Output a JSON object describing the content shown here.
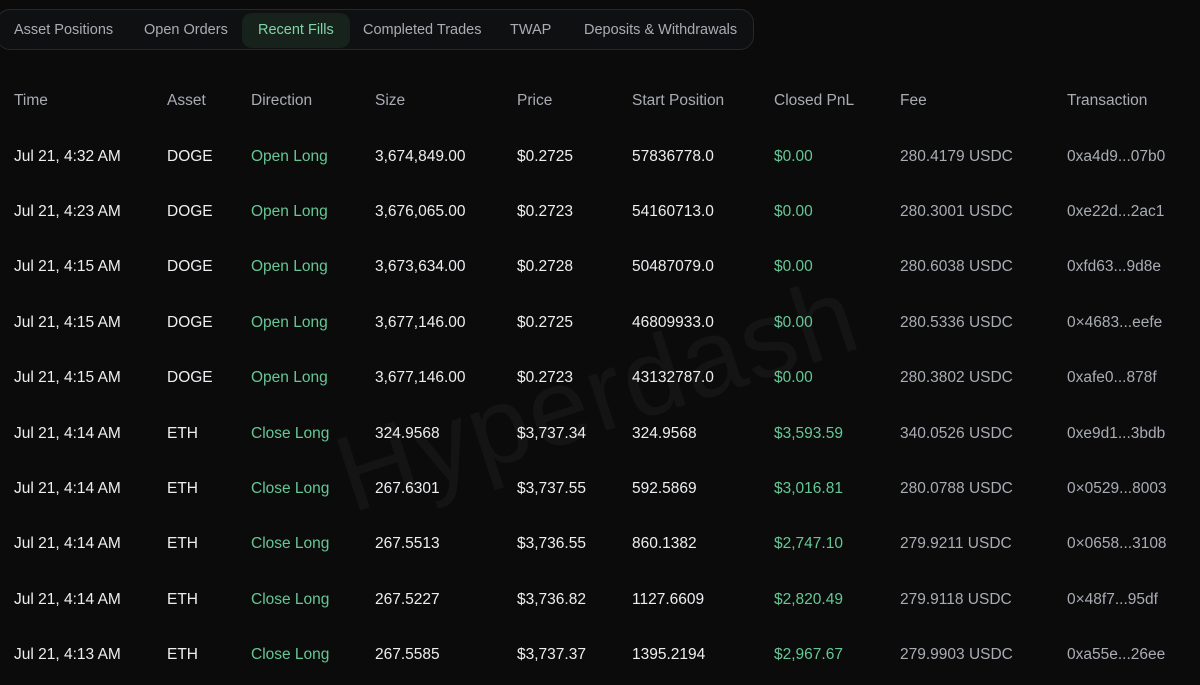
{
  "tabs": [
    {
      "label": "Asset Positions"
    },
    {
      "label": "Open Orders"
    },
    {
      "label": "Recent Fills"
    },
    {
      "label": "Completed Trades"
    },
    {
      "label": "TWAP"
    },
    {
      "label": "Deposits & Withdrawals"
    }
  ],
  "active_tab": "Recent Fills",
  "watermark": "Hyperdash",
  "columns": [
    "Time",
    "Asset",
    "Direction",
    "Size",
    "Price",
    "Start Position",
    "Closed PnL",
    "Fee",
    "Transaction"
  ],
  "rows": [
    {
      "time": "Jul 21, 4:32 AM",
      "asset": "DOGE",
      "direction": "Open Long",
      "size": "3,674,849.00",
      "price": "$0.2725",
      "start": "57836778.0",
      "pnl": "$0.00",
      "fee": "280.4179 USDC",
      "tx": "0xa4d9...07b0"
    },
    {
      "time": "Jul 21, 4:23 AM",
      "asset": "DOGE",
      "direction": "Open Long",
      "size": "3,676,065.00",
      "price": "$0.2723",
      "start": "54160713.0",
      "pnl": "$0.00",
      "fee": "280.3001 USDC",
      "tx": "0xe22d...2ac1"
    },
    {
      "time": "Jul 21, 4:15 AM",
      "asset": "DOGE",
      "direction": "Open Long",
      "size": "3,673,634.00",
      "price": "$0.2728",
      "start": "50487079.0",
      "pnl": "$0.00",
      "fee": "280.6038 USDC",
      "tx": "0xfd63...9d8e"
    },
    {
      "time": "Jul 21, 4:15 AM",
      "asset": "DOGE",
      "direction": "Open Long",
      "size": "3,677,146.00",
      "price": "$0.2725",
      "start": "46809933.0",
      "pnl": "$0.00",
      "fee": "280.5336 USDC",
      "tx": "0×4683...eefe"
    },
    {
      "time": "Jul 21, 4:15 AM",
      "asset": "DOGE",
      "direction": "Open Long",
      "size": "3,677,146.00",
      "price": "$0.2723",
      "start": "43132787.0",
      "pnl": "$0.00",
      "fee": "280.3802 USDC",
      "tx": "0xafe0...878f"
    },
    {
      "time": "Jul 21, 4:14 AM",
      "asset": "ETH",
      "direction": "Close Long",
      "size": "324.9568",
      "price": "$3,737.34",
      "start": "324.9568",
      "pnl": "$3,593.59",
      "fee": "340.0526 USDC",
      "tx": "0xe9d1...3bdb"
    },
    {
      "time": "Jul 21, 4:14 AM",
      "asset": "ETH",
      "direction": "Close Long",
      "size": "267.6301",
      "price": "$3,737.55",
      "start": "592.5869",
      "pnl": "$3,016.81",
      "fee": "280.0788 USDC",
      "tx": "0×0529...8003"
    },
    {
      "time": "Jul 21, 4:14 AM",
      "asset": "ETH",
      "direction": "Close Long",
      "size": "267.5513",
      "price": "$3,736.55",
      "start": "860.1382",
      "pnl": "$2,747.10",
      "fee": "279.9211 USDC",
      "tx": "0×0658...3108"
    },
    {
      "time": "Jul 21, 4:14 AM",
      "asset": "ETH",
      "direction": "Close Long",
      "size": "267.5227",
      "price": "$3,736.82",
      "start": "1127.6609",
      "pnl": "$2,820.49",
      "fee": "279.9118 USDC",
      "tx": "0×48f7...95df"
    },
    {
      "time": "Jul 21, 4:13 AM",
      "asset": "ETH",
      "direction": "Close Long",
      "size": "267.5585",
      "price": "$3,737.37",
      "start": "1395.2194",
      "pnl": "$2,967.67",
      "fee": "279.9903 USDC",
      "tx": "0xa55e...26ee"
    }
  ]
}
